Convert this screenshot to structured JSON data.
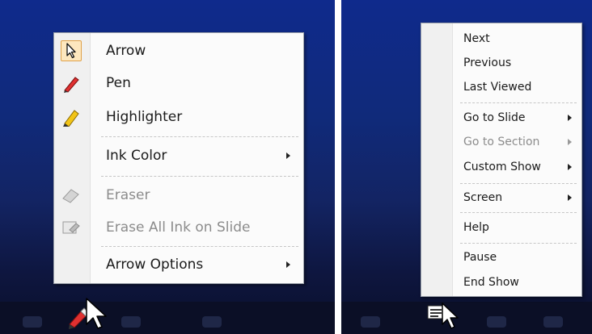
{
  "pen_menu": {
    "items": [
      {
        "label": "Arrow",
        "icon": "arrow-pointer-icon",
        "selected": true,
        "disabled": false
      },
      {
        "label": "Pen",
        "icon": "pen-icon",
        "disabled": false
      },
      {
        "label": "Highlighter",
        "icon": "highlighter-icon",
        "disabled": false
      },
      {
        "label": "Ink Color",
        "submenu": true,
        "disabled": false
      },
      {
        "label": "Eraser",
        "icon": "eraser-icon",
        "disabled": true
      },
      {
        "label": "Erase All Ink on Slide",
        "icon": "erase-all-icon",
        "disabled": true
      },
      {
        "label": "Arrow Options",
        "submenu": true,
        "disabled": false
      }
    ]
  },
  "nav_menu": {
    "items": [
      {
        "label": "Next",
        "disabled": false
      },
      {
        "label": "Previous",
        "disabled": false
      },
      {
        "label": "Last Viewed",
        "disabled": false
      },
      {
        "label": "Go to Slide",
        "submenu": true,
        "disabled": false
      },
      {
        "label": "Go to Section",
        "submenu": true,
        "disabled": true
      },
      {
        "label": "Custom Show",
        "submenu": true,
        "disabled": false
      },
      {
        "label": "Screen",
        "submenu": true,
        "disabled": false
      },
      {
        "label": "Help",
        "disabled": false
      },
      {
        "label": "Pause",
        "disabled": false
      },
      {
        "label": "End Show",
        "disabled": false
      }
    ]
  },
  "colors": {
    "menu_bg": "#fbfbfb",
    "selected_highlight": "#fde7bf",
    "selected_border": "#e0a24a",
    "disabled_text": "#8c8c8c",
    "background_blue": "#102a7a"
  }
}
